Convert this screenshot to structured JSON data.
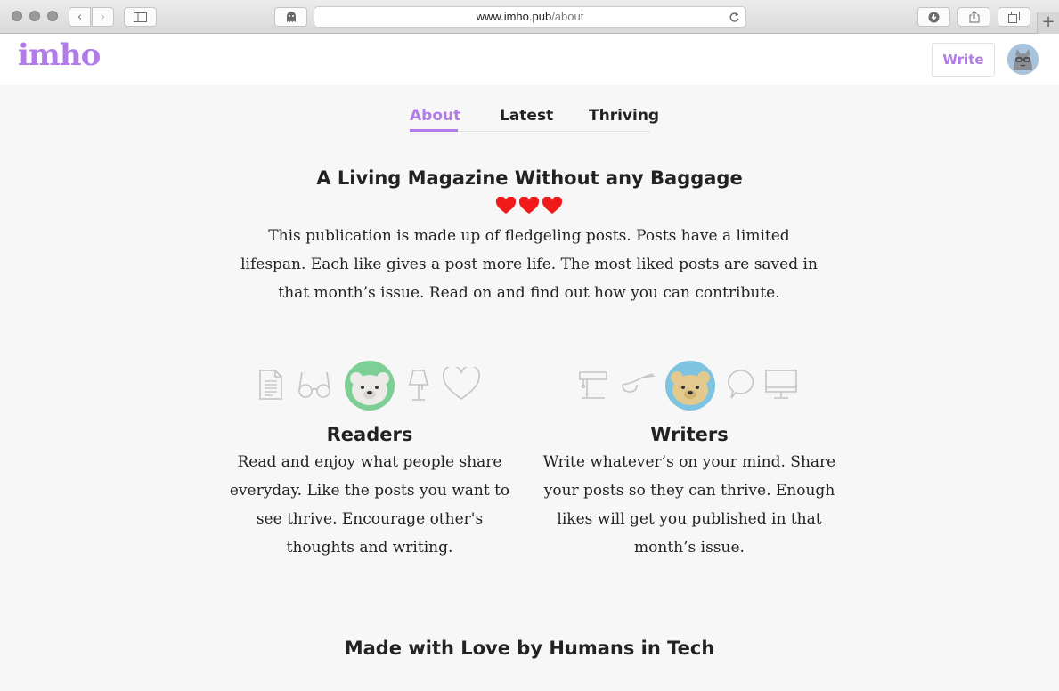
{
  "browser": {
    "url_domain": "www.imho.pub",
    "url_path": "/about",
    "new_tab": "+"
  },
  "header": {
    "logo": "imho",
    "write_label": "Write"
  },
  "tabs": [
    {
      "label": "About",
      "active": true
    },
    {
      "label": "Latest",
      "active": false
    },
    {
      "label": "Thriving",
      "active": false
    }
  ],
  "about": {
    "title": "A Living Magazine Without any Baggage",
    "hearts": 3,
    "intro": "This publication is made up of fledgeling posts. Posts have a limited lifespan. Each like gives a post more life. The most liked posts are saved in that month’s issue. Read on and find out how you can contribute."
  },
  "readers": {
    "title": "Readers",
    "text": "Read and enjoy what people share everyday. Like the posts you want to see thrive. Encourage other's thoughts and writing.",
    "icons": [
      "document-icon",
      "glasses-icon",
      "polar-bear-avatar",
      "lamp-icon",
      "heart-outline-icon"
    ]
  },
  "writers": {
    "title": "Writers",
    "text": "Write whatever’s on your mind. Share your posts so they can thrive. Enough likes will get you published in that month’s issue.",
    "icons": [
      "desk-lamp-icon",
      "pipe-icon",
      "bear-avatar",
      "speech-bubble-icon",
      "monitor-icon"
    ]
  },
  "footer": {
    "title": "Made with Love by Humans in Tech"
  },
  "colors": {
    "brand": "#b17ce8",
    "heart": "#f01a1a",
    "icon_gray": "#c4c4c4"
  }
}
